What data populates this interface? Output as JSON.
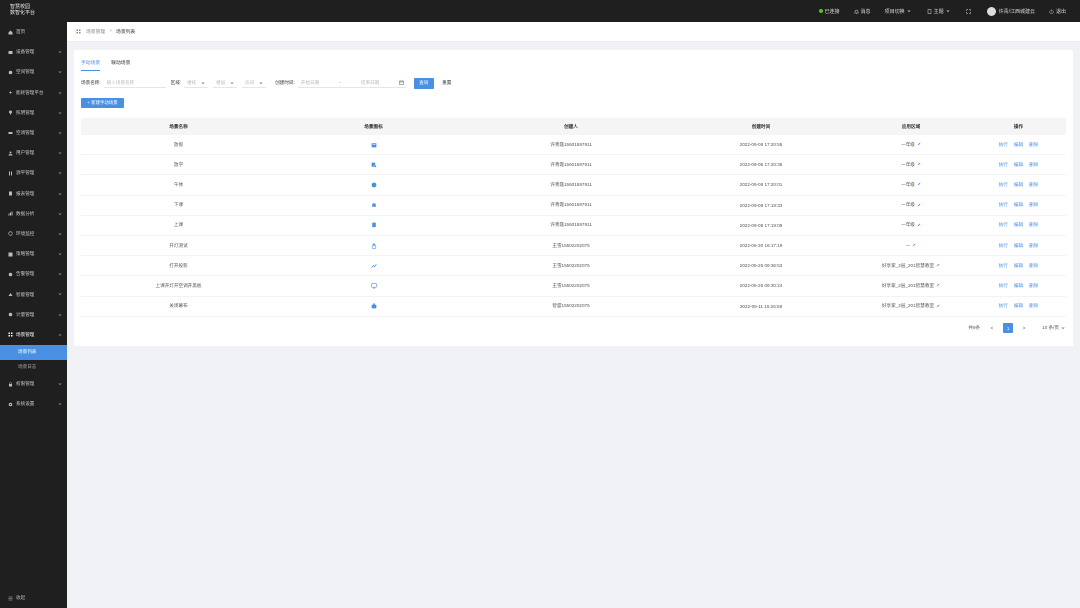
{
  "header": {
    "logo_line1": "智慧校园",
    "logo_line2": "数智化平台",
    "status": "已连接",
    "message": "消息",
    "project_switch": "项目切换",
    "theme": "主题",
    "user": "许青/江西城建云",
    "logout": "退出"
  },
  "sidebar": {
    "items": [
      {
        "label": "首页",
        "icon": "home-icon"
      },
      {
        "label": "设备管理",
        "icon": "device-icon"
      },
      {
        "label": "空间管理",
        "icon": "space-icon"
      },
      {
        "label": "能耗管理平台",
        "icon": "energy-icon"
      },
      {
        "label": "照明管理",
        "icon": "light-icon"
      },
      {
        "label": "空调管理",
        "icon": "aircon-icon"
      },
      {
        "label": "用户管理",
        "icon": "user-icon"
      },
      {
        "label": "源平管理",
        "icon": "source-icon"
      },
      {
        "label": "报表管理",
        "icon": "report-icon"
      },
      {
        "label": "数据分析",
        "icon": "analysis-icon"
      },
      {
        "label": "环境监控",
        "icon": "env-icon"
      },
      {
        "label": "策略管理",
        "icon": "policy-icon"
      },
      {
        "label": "告警管理",
        "icon": "alarm-icon"
      },
      {
        "label": "智能管理",
        "icon": "smart-icon"
      },
      {
        "label": "计量管理",
        "icon": "meter-icon"
      },
      {
        "label": "场景管理",
        "icon": "scene-icon"
      }
    ],
    "sub_items": [
      "场景列表",
      "场景日志"
    ],
    "after_items": [
      {
        "label": "权限管理",
        "icon": "permission-icon"
      },
      {
        "label": "系统设置",
        "icon": "settings-icon"
      }
    ],
    "collapse": "收起"
  },
  "breadcrumb": {
    "parent": "场景管理",
    "separator": ">",
    "current": "场景列表"
  },
  "tabs": [
    "手动场景",
    "联动场景"
  ],
  "filters": {
    "name_label": "场景名称:",
    "name_placeholder": "输入场景名称",
    "area_label": "区域:",
    "area_select_1": "楼栋",
    "area_select_2": "楼层",
    "area_select_3": "房间",
    "time_label": "创建时间:",
    "start_placeholder": "开始日期",
    "time_sep": "~",
    "end_placeholder": "结束日期",
    "query": "查询",
    "reset": "重置"
  },
  "add_button": "+ 新建手动场景",
  "table": {
    "headers": [
      "场景名称",
      "场景图标",
      "创建人",
      "创建时间",
      "应用区域",
      "操作"
    ],
    "rows": [
      {
        "name": "放假",
        "icon": "calendar-icon",
        "creator": "许青霞15601597911",
        "time": "2022-09-08 17:20:55",
        "area": "一年级"
      },
      {
        "name": "放学",
        "icon": "walk-icon",
        "creator": "许青霞15601597911",
        "time": "2022-09-08 17:20:36",
        "area": "一年级"
      },
      {
        "name": "午休",
        "icon": "moon-icon",
        "creator": "许青霞15601597911",
        "time": "2022-09-08 17:20:01",
        "area": "一年级"
      },
      {
        "name": "下课",
        "icon": "bell-icon",
        "creator": "许青霞15601597911",
        "time": "2022-09-08 17:19:33",
        "area": "一年级"
      },
      {
        "name": "上课",
        "icon": "book-icon",
        "creator": "许青霞15601597911",
        "time": "2022-09-08 17:19:09",
        "area": "一年级"
      },
      {
        "name": "开灯测试",
        "icon": "lamp-icon",
        "creator": "王雪15502202075",
        "time": "2022-06-30 16:17:19",
        "area": "—"
      },
      {
        "name": "打开投影",
        "icon": "projector-icon",
        "creator": "王雪15502202075",
        "time": "2022-05-26 09:36:53",
        "area": "好享家_2层_201智慧教室"
      },
      {
        "name": "上课开灯开空调开黑板",
        "icon": "board-icon",
        "creator": "王雪15502202075",
        "time": "2022-05-26 09:30:24",
        "area": "好享家_2层_201智慧教室"
      },
      {
        "name": "关闭幕布",
        "icon": "curtain-icon",
        "creator": "智盛15502202075",
        "time": "2022-05-11 15:26:58",
        "area": "好享家_2层_201智慧教室"
      }
    ],
    "ops": [
      "执行",
      "编辑",
      "删除"
    ]
  },
  "pagination": {
    "total": "共9条",
    "current_page": "1",
    "page_size": "10 条/页"
  },
  "colors": {
    "primary": "#4a90e2",
    "sidebar_bg": "#1f1f1f",
    "status_green": "#52c41a"
  }
}
